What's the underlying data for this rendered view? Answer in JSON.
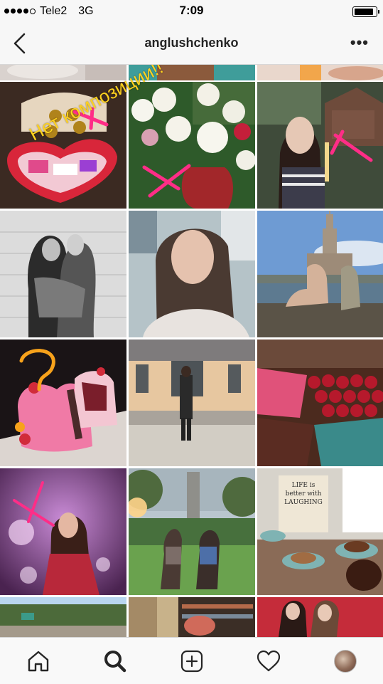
{
  "status_bar": {
    "carrier": "Tele2",
    "network": "3G",
    "time": "7:09",
    "signal_bars": 4,
    "signal_total": 5,
    "battery_level": 0.95
  },
  "header": {
    "username": "anglushchenko",
    "back_icon": "chevron-left-icon",
    "more_icon": "ellipsis-icon",
    "more_label": "•••"
  },
  "grid": {
    "tiles": [
      {
        "id": "t0",
        "alt": "photo"
      },
      {
        "id": "t1",
        "alt": "photo"
      },
      {
        "id": "t2",
        "alt": "photo"
      },
      {
        "id": "t3",
        "alt": "photo",
        "overlay_text": "Нет композиции!!"
      },
      {
        "id": "t4",
        "alt": "photo"
      },
      {
        "id": "t5",
        "alt": "photo"
      },
      {
        "id": "t6",
        "alt": "photo"
      },
      {
        "id": "t7",
        "alt": "photo"
      },
      {
        "id": "t8",
        "alt": "photo"
      },
      {
        "id": "t9",
        "alt": "photo",
        "overlay_text": "?"
      },
      {
        "id": "t10",
        "alt": "photo"
      },
      {
        "id": "t11",
        "alt": "photo"
      },
      {
        "id": "t12",
        "alt": "photo"
      },
      {
        "id": "t13",
        "alt": "photo"
      },
      {
        "id": "t14",
        "alt": "photo",
        "sign_text": "LIFE is better with LAUGHING"
      },
      {
        "id": "t15",
        "alt": "photo"
      },
      {
        "id": "t16",
        "alt": "photo"
      },
      {
        "id": "t17",
        "alt": "photo"
      }
    ]
  },
  "tab_bar": {
    "tabs": [
      {
        "icon": "home-icon",
        "active": false
      },
      {
        "icon": "search-icon",
        "active": true
      },
      {
        "icon": "add-post-icon",
        "active": false
      },
      {
        "icon": "heart-icon",
        "active": false
      },
      {
        "icon": "profile-avatar",
        "active": false
      }
    ]
  },
  "colors": {
    "bar_bg": "#f7f7f7",
    "text": "#262626",
    "annotation_pink": "#ff2d87",
    "annotation_yellow": "#ffd21f",
    "annotation_orange": "#f7a21b"
  }
}
